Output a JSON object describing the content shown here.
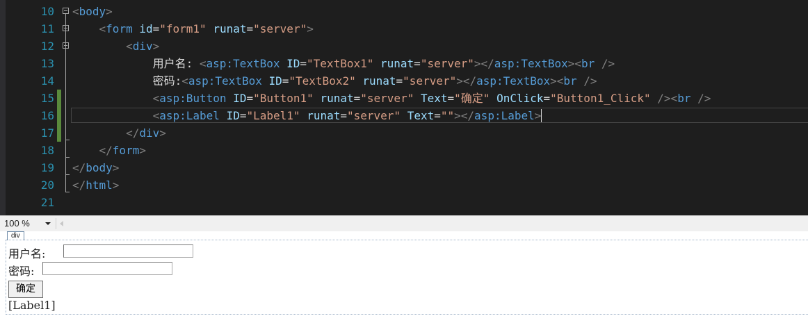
{
  "editor": {
    "lines": [
      {
        "num": "10",
        "code": "<body>"
      },
      {
        "num": "11",
        "code": "<form id=\"form1\" runat=\"server\">"
      },
      {
        "num": "12",
        "code": "<div>"
      },
      {
        "num": "13",
        "code": "用户名: <asp:TextBox ID=\"TextBox1\" runat=\"server\"></asp:TextBox><br />"
      },
      {
        "num": "14",
        "code": "密码:<asp:TextBox ID=\"TextBox2\" runat=\"server\"></asp:TextBox><br />"
      },
      {
        "num": "15",
        "code": "<asp:Button ID=\"Button1\" runat=\"server\" Text=\"确定\" OnClick=\"Button1_Click\" /><br />"
      },
      {
        "num": "16",
        "code": "<asp:Label ID=\"Label1\" runat=\"server\" Text=\"\"></asp:Label>"
      },
      {
        "num": "17",
        "code": "</div>"
      },
      {
        "num": "18",
        "code": "</form>"
      },
      {
        "num": "19",
        "code": "</body>"
      },
      {
        "num": "20",
        "code": "</html>"
      },
      {
        "num": "21",
        "code": ""
      }
    ]
  },
  "zoom": {
    "value": "100 %"
  },
  "design": {
    "div_tag": "div",
    "username_label": "用户名:",
    "password_label": "密码:",
    "button_text": "确定",
    "label_text": "[Label1]"
  },
  "colors": {
    "editor_bg": "#1e1e1e",
    "line_number": "#2b91af",
    "tag": "#569cd6",
    "attribute": "#9cdcfe",
    "attr_value": "#d69d85",
    "punctuation": "#808080",
    "change_bar": "#5a8a3c"
  }
}
